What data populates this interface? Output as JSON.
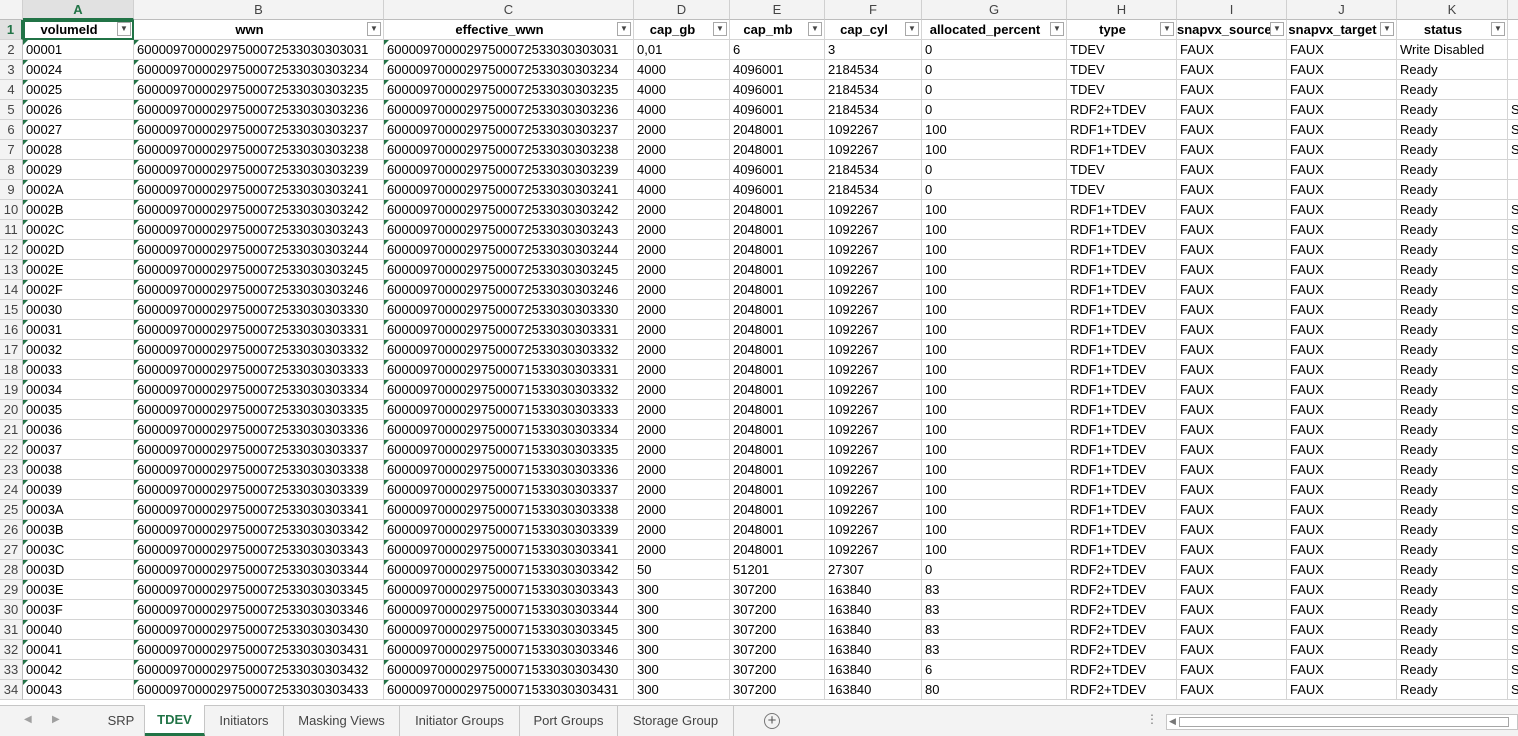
{
  "spreadsheet": {
    "column_letters": [
      "A",
      "B",
      "C",
      "D",
      "E",
      "F",
      "G",
      "H",
      "I",
      "J",
      "K"
    ],
    "headers": [
      "volumeId",
      "wwn",
      "effective_wwn",
      "cap_gb",
      "cap_mb",
      "cap_cyl",
      "allocated_percent",
      "type",
      "snapvx_source",
      "snapvx_target",
      "status"
    ],
    "filter_icon": "filter-dropdown-icon",
    "rows": [
      [
        "00001",
        "60000970000297500072533030303031",
        "60000970000297500072533030303031",
        "0,01",
        "6",
        "3",
        "0",
        "TDEV",
        "FAUX",
        "FAUX",
        "Write Disabled"
      ],
      [
        "00024",
        "60000970000297500072533030303234",
        "60000970000297500072533030303234",
        "4000",
        "4096001",
        "2184534",
        "0",
        "TDEV",
        "FAUX",
        "FAUX",
        "Ready"
      ],
      [
        "00025",
        "60000970000297500072533030303235",
        "60000970000297500072533030303235",
        "4000",
        "4096001",
        "2184534",
        "0",
        "TDEV",
        "FAUX",
        "FAUX",
        "Ready"
      ],
      [
        "00026",
        "60000970000297500072533030303236",
        "60000970000297500072533030303236",
        "4000",
        "4096001",
        "2184534",
        "0",
        "RDF2+TDEV",
        "FAUX",
        "FAUX",
        "Ready"
      ],
      [
        "00027",
        "60000970000297500072533030303237",
        "60000970000297500072533030303237",
        "2000",
        "2048001",
        "1092267",
        "100",
        "RDF1+TDEV",
        "FAUX",
        "FAUX",
        "Ready"
      ],
      [
        "00028",
        "60000970000297500072533030303238",
        "60000970000297500072533030303238",
        "2000",
        "2048001",
        "1092267",
        "100",
        "RDF1+TDEV",
        "FAUX",
        "FAUX",
        "Ready"
      ],
      [
        "00029",
        "60000970000297500072533030303239",
        "60000970000297500072533030303239",
        "4000",
        "4096001",
        "2184534",
        "0",
        "TDEV",
        "FAUX",
        "FAUX",
        "Ready"
      ],
      [
        "0002A",
        "60000970000297500072533030303241",
        "60000970000297500072533030303241",
        "4000",
        "4096001",
        "2184534",
        "0",
        "TDEV",
        "FAUX",
        "FAUX",
        "Ready"
      ],
      [
        "0002B",
        "60000970000297500072533030303242",
        "60000970000297500072533030303242",
        "2000",
        "2048001",
        "1092267",
        "100",
        "RDF1+TDEV",
        "FAUX",
        "FAUX",
        "Ready"
      ],
      [
        "0002C",
        "60000970000297500072533030303243",
        "60000970000297500072533030303243",
        "2000",
        "2048001",
        "1092267",
        "100",
        "RDF1+TDEV",
        "FAUX",
        "FAUX",
        "Ready"
      ],
      [
        "0002D",
        "60000970000297500072533030303244",
        "60000970000297500072533030303244",
        "2000",
        "2048001",
        "1092267",
        "100",
        "RDF1+TDEV",
        "FAUX",
        "FAUX",
        "Ready"
      ],
      [
        "0002E",
        "60000970000297500072533030303245",
        "60000970000297500072533030303245",
        "2000",
        "2048001",
        "1092267",
        "100",
        "RDF1+TDEV",
        "FAUX",
        "FAUX",
        "Ready"
      ],
      [
        "0002F",
        "60000970000297500072533030303246",
        "60000970000297500072533030303246",
        "2000",
        "2048001",
        "1092267",
        "100",
        "RDF1+TDEV",
        "FAUX",
        "FAUX",
        "Ready"
      ],
      [
        "00030",
        "60000970000297500072533030303330",
        "60000970000297500072533030303330",
        "2000",
        "2048001",
        "1092267",
        "100",
        "RDF1+TDEV",
        "FAUX",
        "FAUX",
        "Ready"
      ],
      [
        "00031",
        "60000970000297500072533030303331",
        "60000970000297500072533030303331",
        "2000",
        "2048001",
        "1092267",
        "100",
        "RDF1+TDEV",
        "FAUX",
        "FAUX",
        "Ready"
      ],
      [
        "00032",
        "60000970000297500072533030303332",
        "60000970000297500072533030303332",
        "2000",
        "2048001",
        "1092267",
        "100",
        "RDF1+TDEV",
        "FAUX",
        "FAUX",
        "Ready"
      ],
      [
        "00033",
        "60000970000297500072533030303333",
        "60000970000297500071533030303331",
        "2000",
        "2048001",
        "1092267",
        "100",
        "RDF1+TDEV",
        "FAUX",
        "FAUX",
        "Ready"
      ],
      [
        "00034",
        "60000970000297500072533030303334",
        "60000970000297500071533030303332",
        "2000",
        "2048001",
        "1092267",
        "100",
        "RDF1+TDEV",
        "FAUX",
        "FAUX",
        "Ready"
      ],
      [
        "00035",
        "60000970000297500072533030303335",
        "60000970000297500071533030303333",
        "2000",
        "2048001",
        "1092267",
        "100",
        "RDF1+TDEV",
        "FAUX",
        "FAUX",
        "Ready"
      ],
      [
        "00036",
        "60000970000297500072533030303336",
        "60000970000297500071533030303334",
        "2000",
        "2048001",
        "1092267",
        "100",
        "RDF1+TDEV",
        "FAUX",
        "FAUX",
        "Ready"
      ],
      [
        "00037",
        "60000970000297500072533030303337",
        "60000970000297500071533030303335",
        "2000",
        "2048001",
        "1092267",
        "100",
        "RDF1+TDEV",
        "FAUX",
        "FAUX",
        "Ready"
      ],
      [
        "00038",
        "60000970000297500072533030303338",
        "60000970000297500071533030303336",
        "2000",
        "2048001",
        "1092267",
        "100",
        "RDF1+TDEV",
        "FAUX",
        "FAUX",
        "Ready"
      ],
      [
        "00039",
        "60000970000297500072533030303339",
        "60000970000297500071533030303337",
        "2000",
        "2048001",
        "1092267",
        "100",
        "RDF1+TDEV",
        "FAUX",
        "FAUX",
        "Ready"
      ],
      [
        "0003A",
        "60000970000297500072533030303341",
        "60000970000297500071533030303338",
        "2000",
        "2048001",
        "1092267",
        "100",
        "RDF1+TDEV",
        "FAUX",
        "FAUX",
        "Ready"
      ],
      [
        "0003B",
        "60000970000297500072533030303342",
        "60000970000297500071533030303339",
        "2000",
        "2048001",
        "1092267",
        "100",
        "RDF1+TDEV",
        "FAUX",
        "FAUX",
        "Ready"
      ],
      [
        "0003C",
        "60000970000297500072533030303343",
        "60000970000297500071533030303341",
        "2000",
        "2048001",
        "1092267",
        "100",
        "RDF1+TDEV",
        "FAUX",
        "FAUX",
        "Ready"
      ],
      [
        "0003D",
        "60000970000297500072533030303344",
        "60000970000297500071533030303342",
        "50",
        "51201",
        "27307",
        "0",
        "RDF2+TDEV",
        "FAUX",
        "FAUX",
        "Ready"
      ],
      [
        "0003E",
        "60000970000297500072533030303345",
        "60000970000297500071533030303343",
        "300",
        "307200",
        "163840",
        "83",
        "RDF2+TDEV",
        "FAUX",
        "FAUX",
        "Ready"
      ],
      [
        "0003F",
        "60000970000297500072533030303346",
        "60000970000297500071533030303344",
        "300",
        "307200",
        "163840",
        "83",
        "RDF2+TDEV",
        "FAUX",
        "FAUX",
        "Ready"
      ],
      [
        "00040",
        "60000970000297500072533030303430",
        "60000970000297500071533030303345",
        "300",
        "307200",
        "163840",
        "83",
        "RDF2+TDEV",
        "FAUX",
        "FAUX",
        "Ready"
      ],
      [
        "00041",
        "60000970000297500072533030303431",
        "60000970000297500071533030303346",
        "300",
        "307200",
        "163840",
        "83",
        "RDF2+TDEV",
        "FAUX",
        "FAUX",
        "Ready"
      ],
      [
        "00042",
        "60000970000297500072533030303432",
        "60000970000297500071533030303430",
        "300",
        "307200",
        "163840",
        "6",
        "RDF2+TDEV",
        "FAUX",
        "FAUX",
        "Ready"
      ],
      [
        "00043",
        "60000970000297500072533030303433",
        "60000970000297500071533030303431",
        "300",
        "307200",
        "163840",
        "80",
        "RDF2+TDEV",
        "FAUX",
        "FAUX",
        "Ready"
      ]
    ],
    "overflow_col_l": [
      "",
      "",
      "",
      "S",
      "S",
      "S",
      "",
      "",
      "S",
      "S",
      "S",
      "S",
      "S",
      "S",
      "S",
      "S",
      "S",
      "S",
      "S",
      "S",
      "S",
      "S",
      "S",
      "S",
      "S",
      "S",
      "S",
      "S",
      "S",
      "S",
      "S",
      "S",
      "S"
    ]
  },
  "sheet_tabs": {
    "tabs": [
      "SRP",
      "TDEV",
      "Initiators",
      "Masking Views",
      "Initiator Groups",
      "Port Groups",
      "Storage Group"
    ],
    "active": "TDEV",
    "add_icon": "plus-circle-icon",
    "more_icon": "ellipsis-icon"
  },
  "colors": {
    "accent": "#217346",
    "gridline": "#d4d4d4",
    "header_bg": "#f3f3f3"
  }
}
